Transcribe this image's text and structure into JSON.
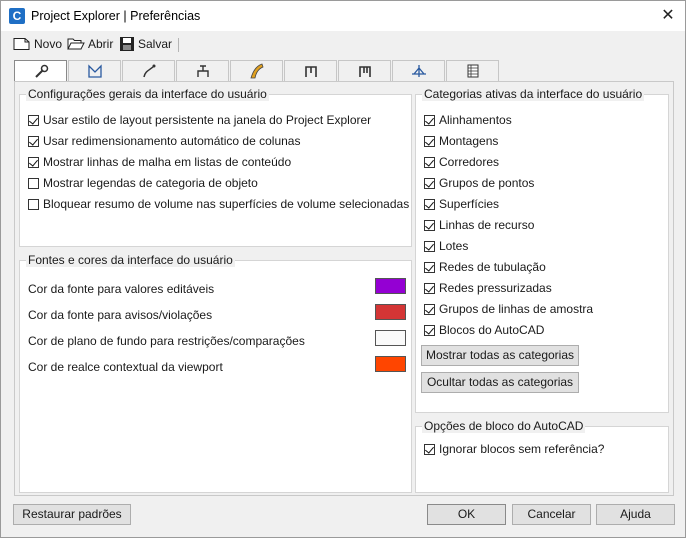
{
  "window": {
    "title": "Project Explorer | Preferências",
    "app_icon_letter": "C"
  },
  "toolbar": {
    "new_label": "Novo",
    "open_label": "Abrir",
    "save_label": "Salvar"
  },
  "tabs": [
    {
      "icon": "wrench-icon"
    },
    {
      "icon": "surface-icon"
    },
    {
      "icon": "alignment-icon"
    },
    {
      "icon": "point-group-icon"
    },
    {
      "icon": "corridor-icon"
    },
    {
      "icon": "pipe-network-icon"
    },
    {
      "icon": "pressure-network-icon"
    },
    {
      "icon": "sample-lines-icon"
    },
    {
      "icon": "table-icon"
    }
  ],
  "general": {
    "title": "Configurações gerais da interface do usuário",
    "options": [
      {
        "label": "Usar estilo de layout persistente na janela do Project Explorer",
        "checked": true
      },
      {
        "label": "Usar redimensionamento automático de colunas",
        "checked": true
      },
      {
        "label": "Mostrar linhas de malha em listas de conteúdo",
        "checked": true
      },
      {
        "label": "Mostrar legendas de categoria de objeto",
        "checked": false
      },
      {
        "label": "Bloquear resumo de volume nas superfícies de volume selecionadas",
        "checked": false
      }
    ]
  },
  "fonts": {
    "title": "Fontes e cores da interface do usuário",
    "items": [
      {
        "label": "Cor da fonte para valores editáveis",
        "color": "#9400d3"
      },
      {
        "label": "Cor da fonte para avisos/violações",
        "color": "#d43535"
      },
      {
        "label": "Cor de plano de fundo para restrições/comparações",
        "color": "#fafafa"
      },
      {
        "label": "Cor de realce contextual da viewport",
        "color": "#ff4500"
      }
    ]
  },
  "categories": {
    "title": "Categorias ativas da interface do usuário",
    "items": [
      {
        "label": "Alinhamentos",
        "checked": true
      },
      {
        "label": "Montagens",
        "checked": true
      },
      {
        "label": "Corredores",
        "checked": true
      },
      {
        "label": "Grupos de pontos",
        "checked": true
      },
      {
        "label": "Superfícies",
        "checked": true
      },
      {
        "label": "Linhas de recurso",
        "checked": true
      },
      {
        "label": "Lotes",
        "checked": true
      },
      {
        "label": "Redes de tubulação",
        "checked": true
      },
      {
        "label": "Redes pressurizadas",
        "checked": true
      },
      {
        "label": "Grupos de linhas de amostra",
        "checked": true
      },
      {
        "label": "Blocos do AutoCAD",
        "checked": true
      }
    ],
    "show_all_label": "Mostrar todas as categorias",
    "hide_all_label": "Ocultar todas as categorias"
  },
  "block_options": {
    "title": "Opções de bloco do AutoCAD",
    "ignore_label": "Ignorar blocos sem referência?",
    "ignore_checked": true
  },
  "footer": {
    "restore_label": "Restaurar padrões",
    "ok_label": "OK",
    "cancel_label": "Cancelar",
    "help_label": "Ajuda"
  }
}
